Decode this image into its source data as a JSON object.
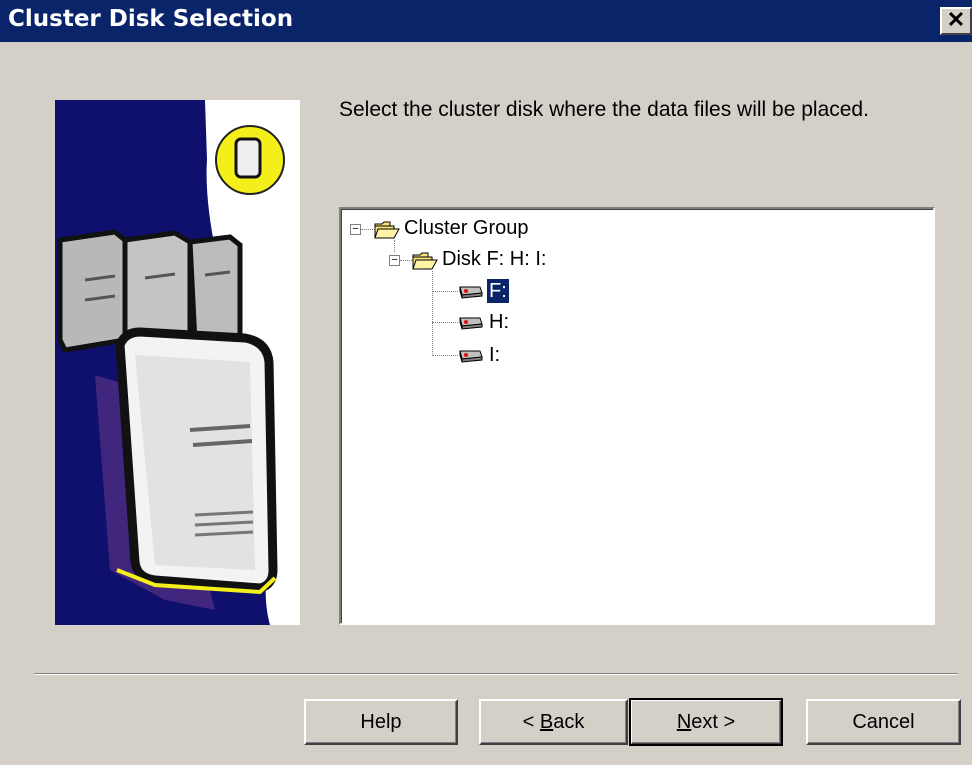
{
  "window": {
    "title": "Cluster Disk Selection",
    "close_glyph": "✕",
    "titlebar_color": "#0a246a"
  },
  "instruction": "Select the cluster disk where the data files will be placed.",
  "tree": {
    "root": {
      "label": "Cluster Group",
      "expanded": true,
      "icon": "folder-open-icon"
    },
    "group": {
      "label": "Disk F: H: I:",
      "expanded": true,
      "icon": "folder-open-icon"
    },
    "disks": [
      {
        "label": "F:",
        "icon": "drive-icon",
        "selected": true
      },
      {
        "label": "H:",
        "icon": "drive-icon",
        "selected": false
      },
      {
        "label": "I:",
        "icon": "drive-icon",
        "selected": false
      }
    ],
    "expander_glyph": "−"
  },
  "buttons": {
    "help": "Help",
    "back_prefix": "< ",
    "back_accel": "B",
    "back_rest": "ack",
    "next_accel": "N",
    "next_rest": "ext >",
    "cancel": "Cancel"
  },
  "colors": {
    "selection": "#0a246a",
    "art_navy": "#0f0f6e",
    "art_yellow": "#f4ee1a"
  }
}
